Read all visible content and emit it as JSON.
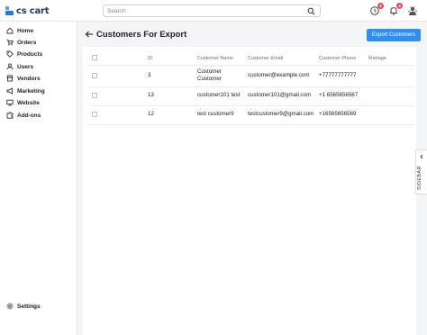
{
  "brand": {
    "logo_text": "cs cart"
  },
  "search": {
    "placeholder": "Search"
  },
  "header_icons": {
    "notifications_badge": "2",
    "alerts_badge": "4"
  },
  "sidebar": {
    "items": [
      {
        "label": "Home",
        "icon": "home-icon"
      },
      {
        "label": "Orders",
        "icon": "cart-icon"
      },
      {
        "label": "Products",
        "icon": "tag-icon"
      },
      {
        "label": "Users",
        "icon": "user-icon"
      },
      {
        "label": "Vendors",
        "icon": "vendors-icon"
      },
      {
        "label": "Marketing",
        "icon": "megaphone-icon"
      },
      {
        "label": "Website",
        "icon": "monitor-icon"
      },
      {
        "label": "Add-ons",
        "icon": "puzzle-icon"
      }
    ],
    "settings_label": "Settings"
  },
  "page": {
    "title": "Customers For Export",
    "export_button": "Export Customers"
  },
  "table": {
    "headers": {
      "id": "ID",
      "name": "Customer Name",
      "email": "Customer Email",
      "phone": "Customer Phone",
      "manage": "Manage"
    },
    "rows": [
      {
        "id": "3",
        "name_line1": "Customer",
        "name_line2": "Customer",
        "email": "customer@example.com",
        "phone": "+77777777777"
      },
      {
        "id": "13",
        "name_line1": "customer101 test",
        "name_line2": "",
        "email": "customer101@gmail.com",
        "phone": "+1 6565656567"
      },
      {
        "id": "12",
        "name_line1": "test customer9",
        "name_line2": "",
        "email": "testcustomer9@gmail.com",
        "phone": "+16565656569"
      }
    ]
  },
  "right_sidebar": {
    "label": "SIDEBAR"
  },
  "colors": {
    "accent": "#2f8ff0",
    "badge": "#e74c5a",
    "brand_dark": "#1e3b6a",
    "main_bg": "#f4f5f7"
  }
}
